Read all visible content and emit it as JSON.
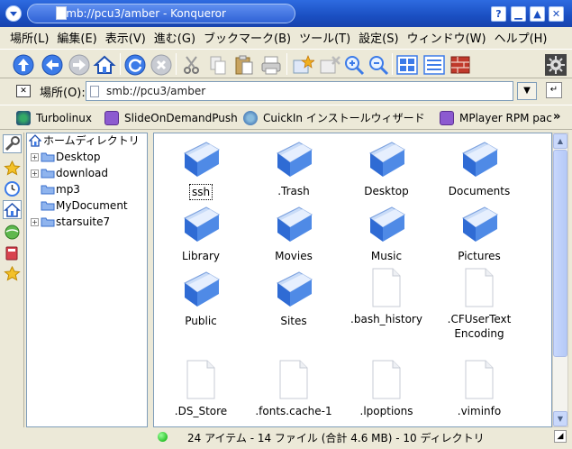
{
  "window": {
    "title": "smb://pcu3/amber - Konqueror"
  },
  "menubar": {
    "items": [
      "場所(L)",
      "編集(E)",
      "表示(V)",
      "進む(G)",
      "ブックマーク(B)",
      "ツール(T)",
      "設定(S)",
      "ウィンドウ(W)",
      "ヘルプ(H)"
    ]
  },
  "toolbar": {
    "buttons": [
      "up",
      "back",
      "forward",
      "home",
      "reload",
      "stop",
      "cut",
      "copy",
      "paste",
      "print",
      "new-window",
      "close",
      "zoom-in",
      "zoom-out",
      "icon-view",
      "detail-view",
      "firewall"
    ]
  },
  "location": {
    "label": "場所(O):",
    "value": "smb://pcu3/amber"
  },
  "bookmarks": [
    "Turbolinux",
    "SlideOnDemandPush",
    "CuickIn インストールウィザード",
    "MPlayer RPM pac"
  ],
  "tree": {
    "root": "ホームディレクトリ",
    "children": [
      "Desktop",
      "download",
      "mp3",
      "MyDocument",
      "starsuite7"
    ]
  },
  "files": [
    {
      "name": "ssh",
      "type": "folder"
    },
    {
      "name": ".Trash",
      "type": "folder"
    },
    {
      "name": "Desktop",
      "type": "folder"
    },
    {
      "name": "Documents",
      "type": "folder"
    },
    {
      "name": "Library",
      "type": "folder"
    },
    {
      "name": "Movies",
      "type": "folder"
    },
    {
      "name": "Music",
      "type": "folder"
    },
    {
      "name": "Pictures",
      "type": "folder"
    },
    {
      "name": "Public",
      "type": "folder"
    },
    {
      "name": "Sites",
      "type": "folder"
    },
    {
      "name": ".bash_history",
      "type": "file"
    },
    {
      "name": ".CFUserTextEncoding",
      "type": "file"
    },
    {
      "name": ".DS_Store",
      "type": "file"
    },
    {
      "name": ".fonts.cache-1",
      "type": "file"
    },
    {
      "name": ".lpoptions",
      "type": "file"
    },
    {
      "name": ".viminfo",
      "type": "file"
    }
  ],
  "status": {
    "text": "24 アイテム - 14 ファイル (合計 4.6 MB) - 10 ディレクトリ"
  },
  "colors": {
    "titlebar": "#1a4fc2",
    "folder": "#3a78e0",
    "selection": "#316ac5"
  }
}
